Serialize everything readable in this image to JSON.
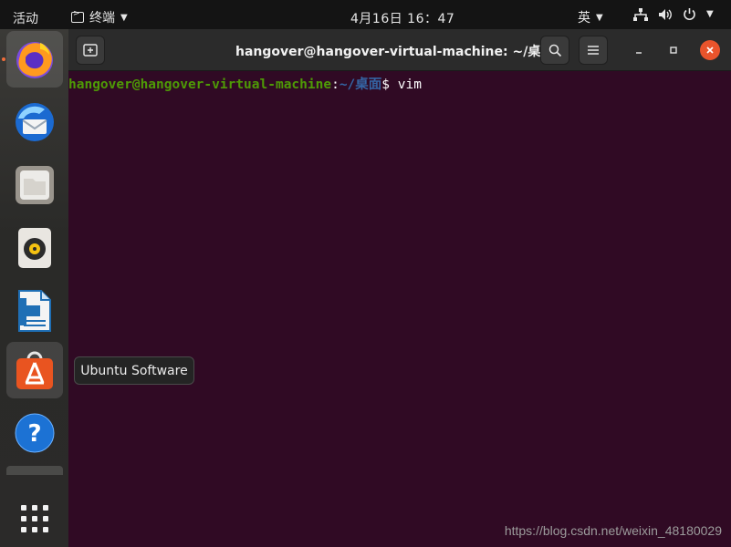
{
  "topbar": {
    "activities": "活动",
    "app_name": "终端",
    "clock": "4月16日  16：47",
    "input_method": "英"
  },
  "dock": {
    "items": [
      {
        "name": "Firefox",
        "icon": "firefox-icon"
      },
      {
        "name": "Thunderbird",
        "icon": "thunderbird-icon"
      },
      {
        "name": "Files",
        "icon": "files-icon"
      },
      {
        "name": "Rhythmbox",
        "icon": "rhythmbox-icon"
      },
      {
        "name": "LibreOffice Writer",
        "icon": "writer-icon"
      },
      {
        "name": "Ubuntu Software",
        "icon": "ubuntu-software-icon"
      },
      {
        "name": "Help",
        "icon": "help-icon"
      },
      {
        "name": "Show Applications",
        "icon": "app-grid-icon"
      }
    ],
    "tooltip": "Ubuntu Software"
  },
  "terminal": {
    "title": "hangover@hangover-virtual-machine: ~/桌面",
    "prompt_user": "hangover@hangover-virtual-machine",
    "prompt_sep": ":",
    "prompt_path": "~/桌面",
    "prompt_dollar": "$ ",
    "command": "vim"
  },
  "watermark": "https://blog.csdn.net/weixin_48180029",
  "colors": {
    "terminal_bg": "#300a24",
    "prompt_user": "#4e9a06",
    "prompt_path": "#3465a4",
    "close_button": "#e9542c",
    "ubuntu_orange": "#f06d3b"
  }
}
